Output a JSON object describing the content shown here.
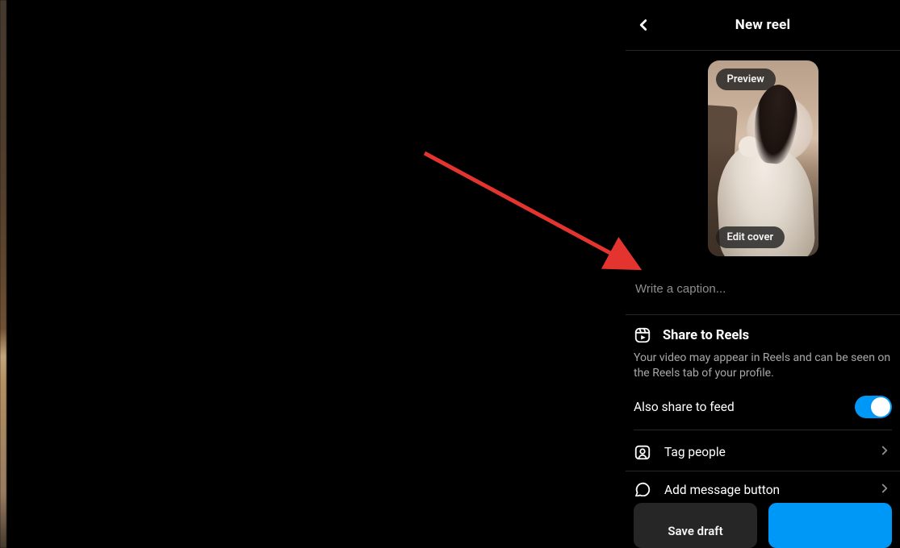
{
  "header": {
    "title": "New reel"
  },
  "cover": {
    "preview_label": "Preview",
    "edit_cover_label": "Edit cover"
  },
  "caption": {
    "placeholder": "Write a caption..."
  },
  "share": {
    "title": "Share to Reels",
    "description": "Your video may appear in Reels and can be seen on the Reels tab of your profile.",
    "also_feed_label": "Also share to feed",
    "also_feed_on": true
  },
  "options": [
    {
      "icon": "tag-people-icon",
      "label": "Tag people"
    },
    {
      "icon": "message-icon",
      "label": "Add message button"
    }
  ],
  "footer": {
    "save_draft_label": "Save draft",
    "share_label": ""
  },
  "colors": {
    "accent": "#0098f7",
    "divider": "#262626",
    "muted": "#8e8e8e"
  }
}
